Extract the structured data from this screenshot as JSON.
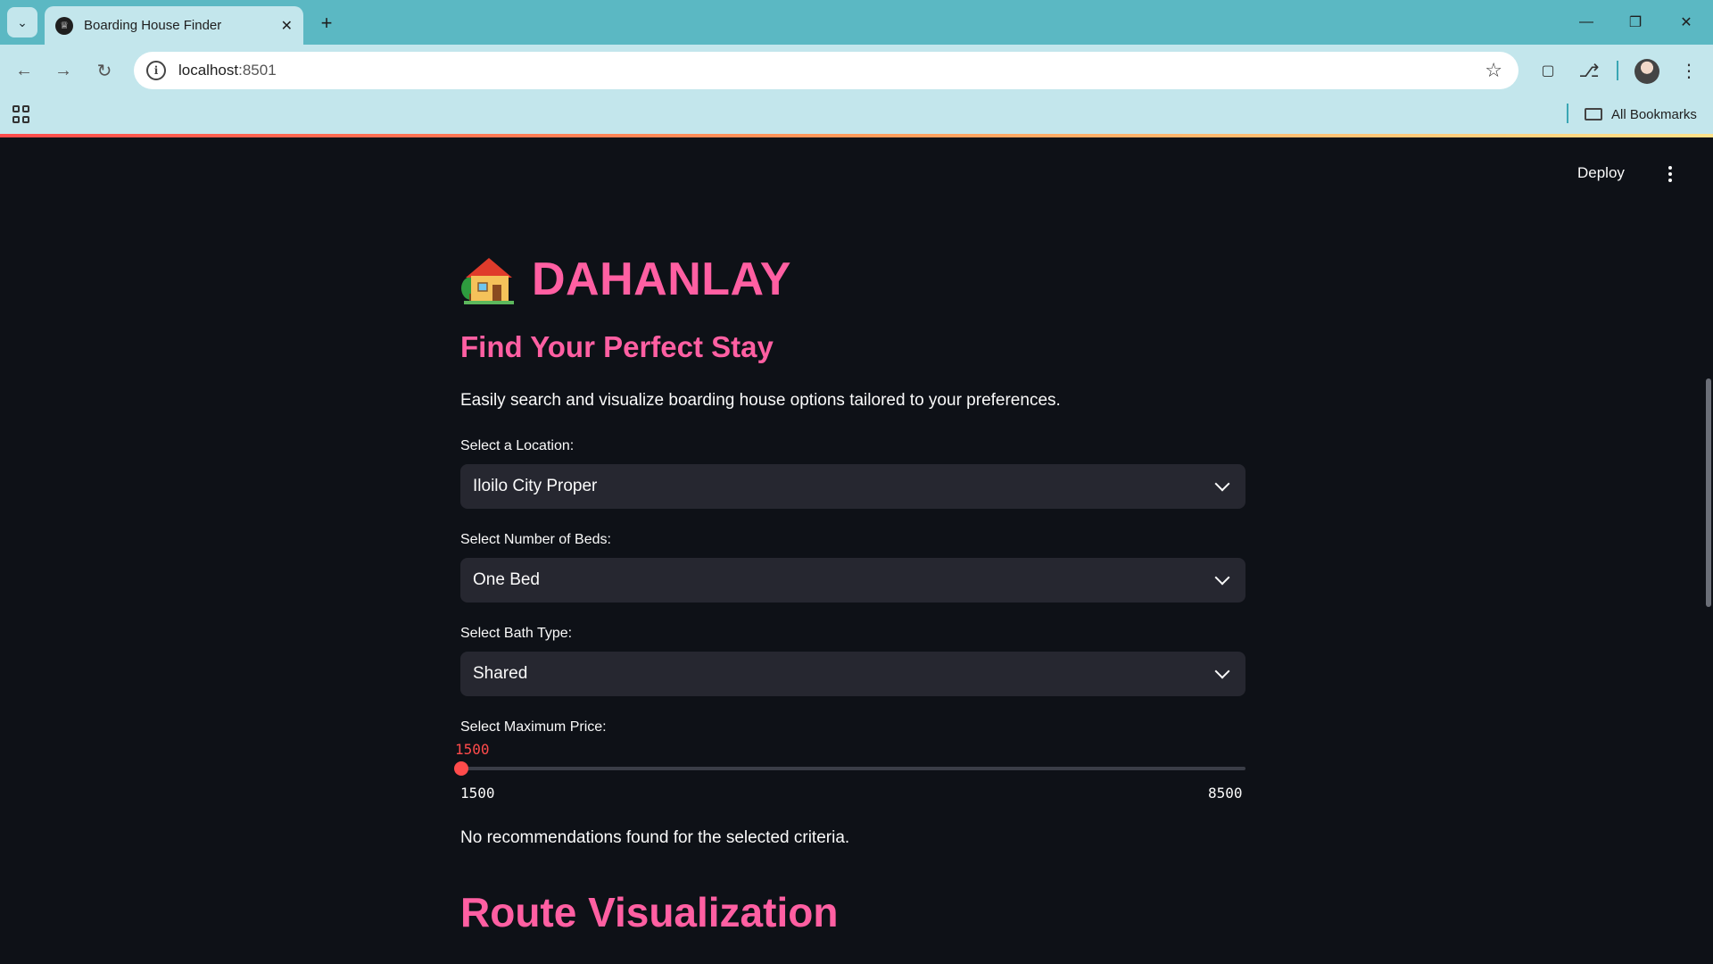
{
  "browser": {
    "tab_title": "Boarding House Finder",
    "url_host": "localhost",
    "url_port": ":8501",
    "all_bookmarks_label": "All Bookmarks"
  },
  "app": {
    "deploy_label": "Deploy",
    "title": "DAHANLAY",
    "title_icon": "house-with-garden-emoji",
    "subheading": "Find Your Perfect Stay",
    "intro": "Easily search and visualize boarding house options tailored to your preferences.",
    "location": {
      "label": "Select a Location:",
      "value": "Iloilo City Proper"
    },
    "beds": {
      "label": "Select Number of Beds:",
      "value": "One Bed"
    },
    "bath": {
      "label": "Select Bath Type:",
      "value": "Shared"
    },
    "price": {
      "label": "Select Maximum Price:",
      "value": "1500",
      "min": "1500",
      "max": "8500"
    },
    "no_results": "No recommendations found for the selected criteria.",
    "route_title": "Route Visualization"
  },
  "colors": {
    "accent": "#ff4b4b",
    "heading": "#ff5fa2",
    "background": "#0e1117",
    "input_bg": "#262730",
    "chrome": "#5bb8c3"
  }
}
